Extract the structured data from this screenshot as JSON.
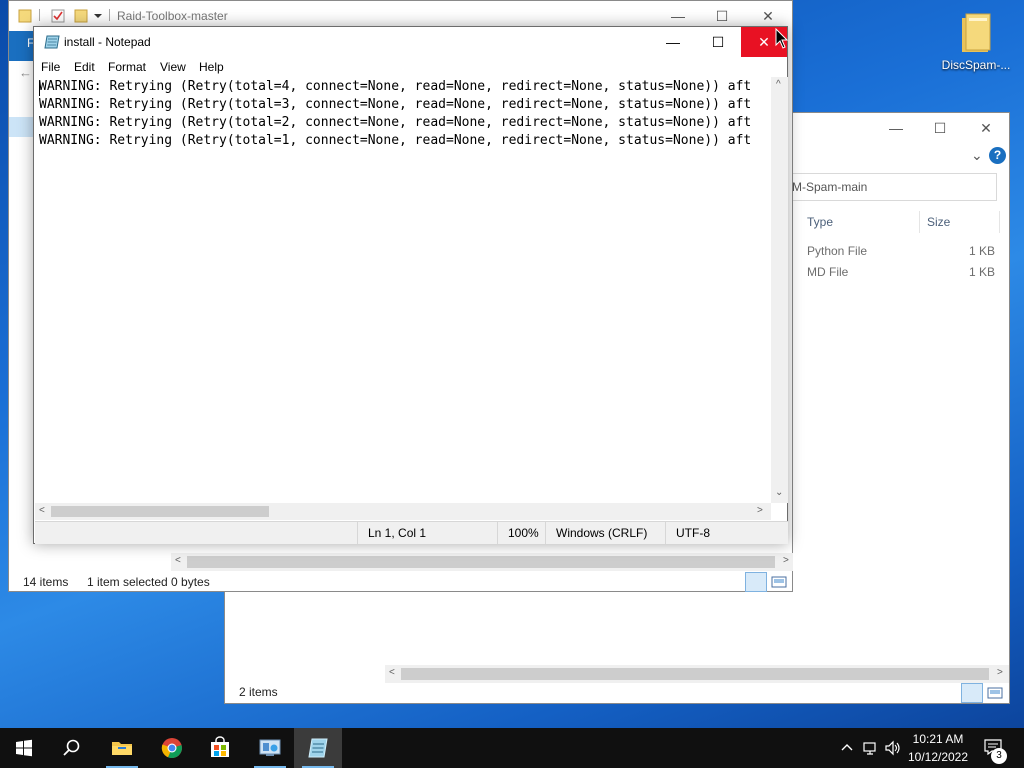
{
  "desktop": {
    "icon_label": "DiscSpam-..."
  },
  "explorer_back": {
    "address_text": "M-Spam-main",
    "columns": [
      "Type",
      "Size"
    ],
    "rows": [
      {
        "type": "Python File",
        "size": "1 KB"
      },
      {
        "type": "MD File",
        "size": "1 KB"
      }
    ],
    "status": "2 items",
    "help_glyph": "?",
    "chevron_glyph": "⌄"
  },
  "explorer_front": {
    "title": "Raid-Toolbox-master",
    "ribbon_file": "F",
    "status_items": "14 items",
    "status_selected": "1 item selected  0 bytes",
    "back_arrow": "←"
  },
  "notepad": {
    "title": "install - Notepad",
    "menu": [
      "File",
      "Edit",
      "Format",
      "View",
      "Help"
    ],
    "lines": [
      "WARNING: Retrying (Retry(total=4, connect=None, read=None, redirect=None, status=None)) aft",
      "WARNING: Retrying (Retry(total=3, connect=None, read=None, redirect=None, status=None)) aft",
      "WARNING: Retrying (Retry(total=2, connect=None, read=None, redirect=None, status=None)) aft",
      "WARNING: Retrying (Retry(total=1, connect=None, read=None, redirect=None, status=None)) aft"
    ],
    "status": {
      "position": "Ln 1, Col 1",
      "zoom": "100%",
      "line_ending": "Windows (CRLF)",
      "encoding": "UTF-8"
    }
  },
  "caption_glyphs": {
    "minimize": "—",
    "maximize": "☐",
    "close": "✕"
  },
  "scroll_glyphs": {
    "left": "<",
    "right": ">",
    "up": "^",
    "down": "⌄"
  },
  "taskbar": {
    "time": "10:21 AM",
    "date": "10/12/2022",
    "notification_count": "3"
  },
  "colors": {
    "accent": "#1a6fc0",
    "close_red": "#e81123",
    "taskbar": "#101010"
  },
  "icons": [
    "windows-start-icon",
    "search-icon",
    "file-explorer-icon",
    "chrome-icon",
    "store-icon",
    "control-panel-icon",
    "notepad-icon",
    "chevron-up-icon",
    "network-icon",
    "volume-icon",
    "notification-icon"
  ]
}
